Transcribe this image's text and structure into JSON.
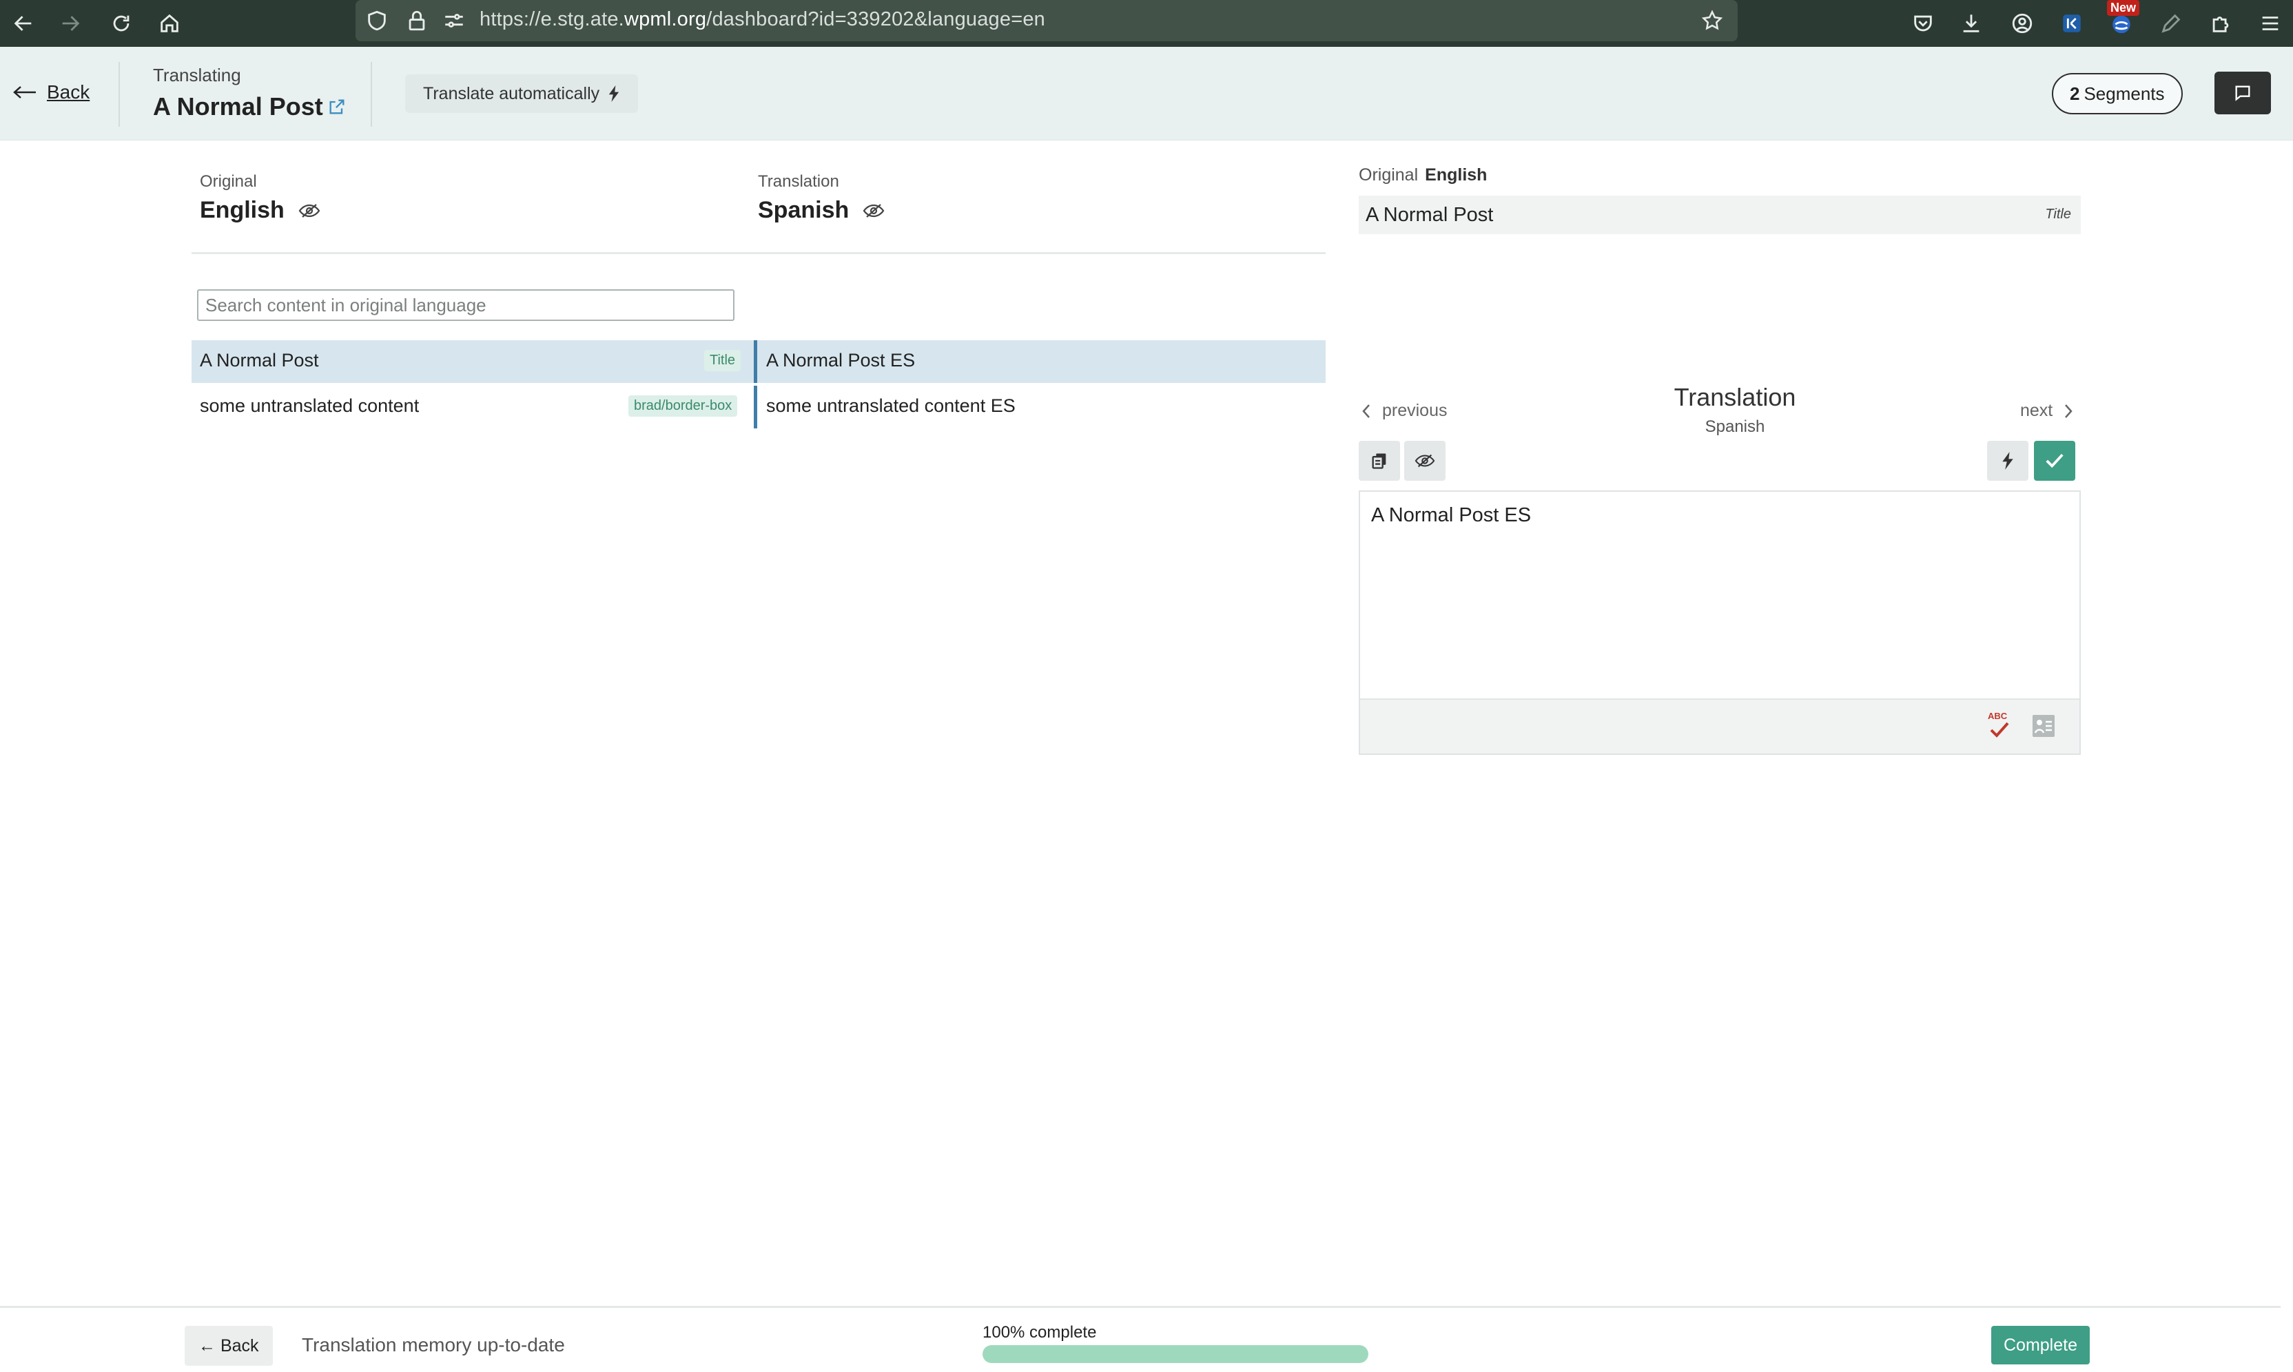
{
  "browser": {
    "url_prefix": "https://e.stg.ate.",
    "url_domain": "wpml.org",
    "url_path": "/dashboard?id=339202&language=en",
    "new_badge": "New",
    "icons": [
      "back-icon",
      "forward-icon",
      "reload-icon",
      "home-icon",
      "shield-icon",
      "lock-icon",
      "site-settings-icon",
      "bookmark-star-icon",
      "pocket-icon",
      "download-icon",
      "account-icon",
      "extension-icon",
      "extension-icon",
      "pen-icon",
      "extensions-puzzle-icon",
      "menu-icon"
    ]
  },
  "header": {
    "back_label": "Back",
    "translating_label": "Translating",
    "post_title": "A Normal Post",
    "auto_translate_label": "Translate automatically",
    "segments_count": "2",
    "segments_label": "Segments"
  },
  "languages": {
    "original_label": "Original",
    "original_name": "English",
    "translation_label": "Translation",
    "translation_name": "Spanish"
  },
  "search": {
    "placeholder": "Search content in original language"
  },
  "segments": [
    {
      "original": "A Normal Post",
      "tag": "Title",
      "translation": "A Normal Post ES",
      "active": true
    },
    {
      "original": "some untranslated content",
      "tag": "brad/border-box",
      "translation": "some untranslated content ES",
      "active": false
    }
  ],
  "editor": {
    "original_label": "Original",
    "original_language": "English",
    "original_text": "A Normal Post",
    "original_tag": "Title",
    "previous_label": "previous",
    "next_label": "next",
    "title": "Translation",
    "subtitle": "Spanish",
    "text": "A Normal Post ES"
  },
  "footer": {
    "back_label": "← Back",
    "status": "Translation memory up-to-date",
    "progress_label": "100% complete",
    "progress_value": 1.0,
    "complete_label": "Complete"
  },
  "colors": {
    "accent_green": "#3e9e86",
    "active_row": "#d7e6ee",
    "row_divider": "#3f7ea8",
    "progress_fill": "#9fd9bd",
    "header_bg": "#e9f0f0"
  }
}
